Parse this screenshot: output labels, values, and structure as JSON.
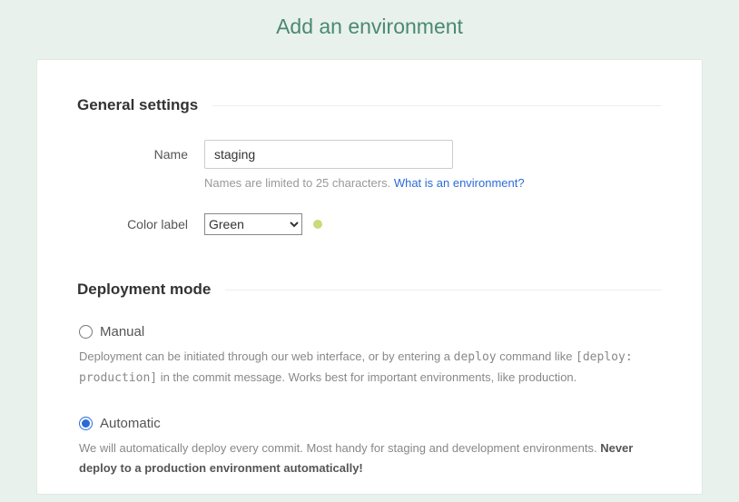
{
  "page_title": "Add an environment",
  "sections": {
    "general": {
      "heading": "General settings",
      "name_label": "Name",
      "name_value": "staging",
      "name_hint_prefix": "Names are limited to 25 characters. ",
      "name_hint_link": "What is an environment?",
      "color_label": "Color label",
      "color_value": "Green",
      "color_swatch": "#cdd97a"
    },
    "deployment": {
      "heading": "Deployment mode",
      "manual": {
        "label": "Manual",
        "desc_1": "Deployment can be initiated through our web interface, or by entering a ",
        "desc_code1": "deploy",
        "desc_2": " command like ",
        "desc_code2": "[deploy: production]",
        "desc_3": " in the commit message. Works best for important environments, like production."
      },
      "automatic": {
        "label": "Automatic",
        "desc_1": "We will automatically deploy every commit. Most handy for staging and development environments. ",
        "desc_strong": "Never deploy to a production environment automatically!"
      },
      "selected": "automatic"
    }
  }
}
